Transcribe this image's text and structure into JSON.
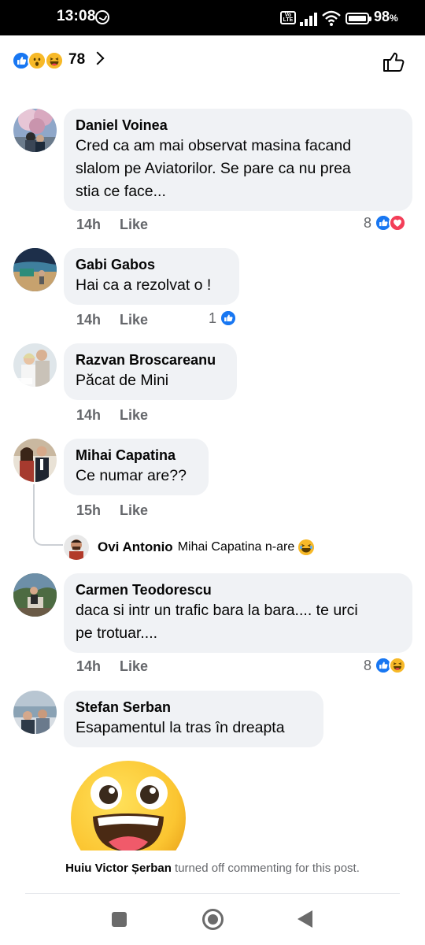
{
  "status_bar": {
    "time": "13:08",
    "network_badge": "Vo LTE",
    "battery_pct": "98",
    "battery_unit": "%",
    "battery_level": 0.98
  },
  "reactions_header": {
    "count": "78",
    "icons": [
      "like-reaction",
      "wow-reaction",
      "haha-reaction"
    ]
  },
  "comments": [
    {
      "author": "Daniel Voinea",
      "text_lines": [
        "Cred ca am mai observat masina facand",
        "slalom pe Aviatorilor. Se pare ca nu prea",
        "stia ce face..."
      ],
      "time": "14h",
      "like_label": "Like",
      "reaction_count": "8",
      "reactions": [
        "like",
        "love"
      ]
    },
    {
      "author": "Gabi Gabos",
      "text_lines": [
        "Hai ca a rezolvat o !"
      ],
      "time": "14h",
      "like_label": "Like",
      "reaction_count": "1",
      "reactions": [
        "like"
      ]
    },
    {
      "author": "Razvan Broscareanu",
      "text_lines": [
        "Păcat de Mini"
      ],
      "time": "14h",
      "like_label": "Like"
    },
    {
      "author": "Mihai Capatina",
      "text_lines": [
        "Ce numar are??"
      ],
      "time": "15h",
      "like_label": "Like",
      "reply": {
        "author": "Ovi Antonio",
        "text": "Mihai Capatina n-are",
        "emoji": "haha-emoji"
      }
    },
    {
      "author": "Carmen Teodorescu",
      "text_lines": [
        "daca si intr un trafic bara la bara.... te urci",
        "pe trotuar...."
      ],
      "time": "14h",
      "like_label": "Like",
      "reaction_count": "8",
      "reactions": [
        "like",
        "haha"
      ]
    },
    {
      "author": "Stefan Serban",
      "text_lines": [
        "Esapamentul la tras în dreapta"
      ],
      "sticker": "grinning-face-sticker"
    }
  ],
  "footer": {
    "owner": "Huiu Victor Șerban",
    "message": " turned off commenting for this post."
  },
  "colors": {
    "accent_like": "#1877f2",
    "love": "#f33e58",
    "haha": "#f7b928",
    "bubble": "#f0f2f5",
    "meta_text": "#65676b"
  }
}
